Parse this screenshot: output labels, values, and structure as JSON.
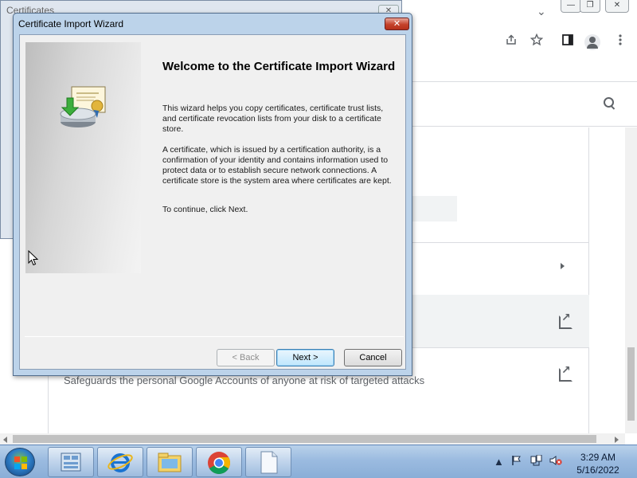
{
  "certificates_window": {
    "title": "Certificates",
    "close_glyph": "✕"
  },
  "chrome": {
    "controls": {
      "minimize": "—",
      "restore": "❐",
      "close": "✕"
    },
    "tab_chevron": "⌄",
    "toolbar_icons": [
      "share-icon",
      "bookmark-star-icon",
      "side-panel-icon",
      "profile-icon",
      "menu-icon"
    ]
  },
  "web_page": {
    "text_row": "Safeguards the personal Google Accounts of anyone at risk of targeted attacks"
  },
  "wizard": {
    "title": "Certificate Import Wizard",
    "close_glyph": "✕",
    "heading": "Welcome to the Certificate Import Wizard",
    "paragraph1": "This wizard helps you copy certificates, certificate trust lists, and certificate revocation lists from your disk to a certificate store.",
    "paragraph2": "A certificate, which is issued by a certification authority, is a confirmation of your identity and contains information used to protect data or to establish secure network connections. A certificate store is the system area where certificates are kept.",
    "paragraph3": "To continue, click Next.",
    "buttons": {
      "back": "< Back",
      "next": "Next >",
      "cancel": "Cancel"
    }
  },
  "taskbar": {
    "pinned": [
      "server-manager-icon",
      "internet-explorer-icon",
      "windows-explorer-icon",
      "chrome-icon",
      "notepad-icon"
    ],
    "clock_time": "3:29 AM",
    "clock_date": "5/16/2022"
  }
}
